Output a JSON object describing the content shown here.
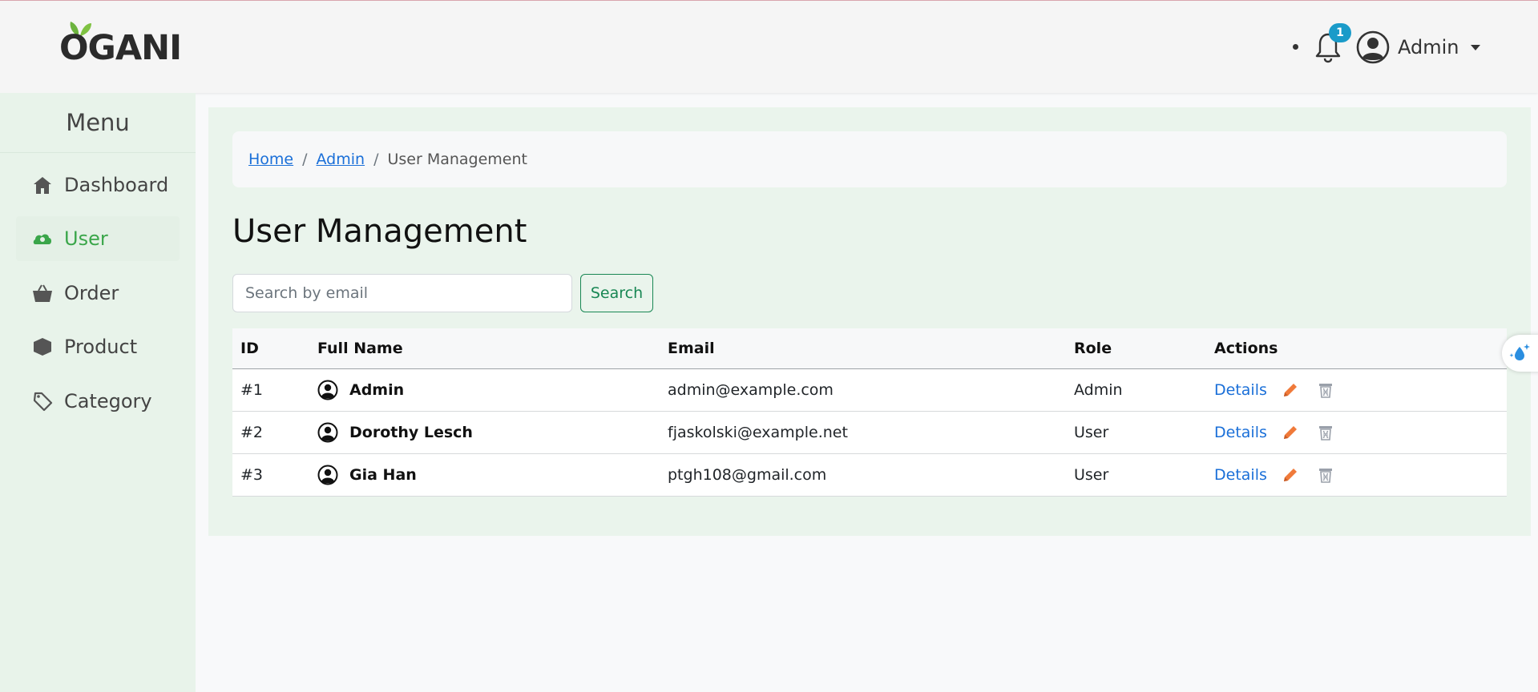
{
  "brand": {
    "logo_text": "OGANI"
  },
  "header": {
    "notification_count": "1",
    "user_name": "Admin",
    "icons": [
      "bell-icon",
      "user-avatar-icon",
      "caret-down-icon"
    ]
  },
  "sidebar": {
    "title": "Menu",
    "items": [
      {
        "label": "Dashboard",
        "icon": "home-icon",
        "active": false
      },
      {
        "label": "User",
        "icon": "user-cloud-icon",
        "active": true
      },
      {
        "label": "Order",
        "icon": "basket-icon",
        "active": false
      },
      {
        "label": "Product",
        "icon": "box-icon",
        "active": false
      },
      {
        "label": "Category",
        "icon": "tag-icon",
        "active": false
      }
    ]
  },
  "breadcrumb": {
    "home": "Home",
    "admin": "Admin",
    "current": "User Management"
  },
  "page": {
    "title": "User Management"
  },
  "search": {
    "placeholder": "Search by email",
    "button_label": "Search"
  },
  "table": {
    "headers": {
      "id": "ID",
      "full_name": "Full Name",
      "email": "Email",
      "role": "Role",
      "actions": "Actions"
    },
    "rows": [
      {
        "id": "#1",
        "full_name": "Admin",
        "email": "admin@example.com",
        "role": "Admin",
        "details": "Details"
      },
      {
        "id": "#2",
        "full_name": "Dorothy Lesch",
        "email": "fjaskolski@example.net",
        "role": "User",
        "details": "Details"
      },
      {
        "id": "#3",
        "full_name": "Gia Han",
        "email": "ptgh108@gmail.com",
        "role": "User",
        "details": "Details"
      }
    ]
  },
  "colors": {
    "accent_green": "#3aa64a",
    "link_blue": "#1a6fd8",
    "badge_blue": "#1a9bc9",
    "edit_orange": "#f07a3a",
    "trash_gray": "#9aa0aa",
    "sidebar_bg": "#e8f3ea",
    "card_bg": "#eaf4ec"
  }
}
